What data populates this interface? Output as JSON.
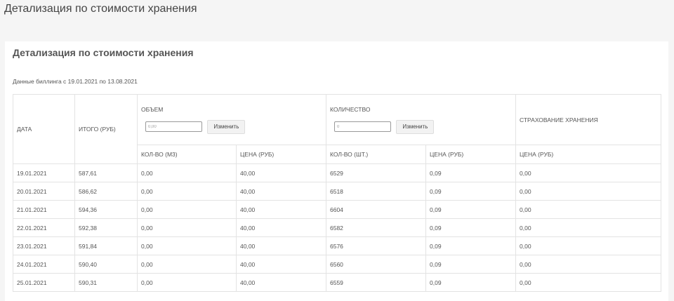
{
  "page": {
    "title": "Детализация по стоимости хранения"
  },
  "card": {
    "title": "Детализация по стоимости хранения",
    "billing_period": "Данные биллинга с 19.01.2021 по 13.08.2021"
  },
  "table": {
    "headers": {
      "date": "ДАТА",
      "total": "ИТОГО (РУБ)",
      "volume_group": "ОБЪЕМ",
      "quantity_group": "КОЛИЧЕСТВО",
      "insurance": "СТРАХОВАНИЕ ХРАНЕНИЯ",
      "vol_qty": "КОЛ-ВО (М3)",
      "vol_price": "ЦЕНА (РУБ)",
      "qty_qty": "КОЛ-ВО (ШТ.)",
      "qty_price": "ЦЕНА (РУБ)",
      "ins_price": "ЦЕНА (РУБ)"
    },
    "volume_input": {
      "value": "0,00"
    },
    "quantity_input": {
      "value": "0"
    },
    "change_label": "Изменить",
    "rows": [
      [
        "19.01.2021",
        "587,61",
        "0,00",
        "40,00",
        "6529",
        "0,09",
        "0,00"
      ],
      [
        "20.01.2021",
        "586,62",
        "0,00",
        "40,00",
        "6518",
        "0,09",
        "0,00"
      ],
      [
        "21.01.2021",
        "594,36",
        "0,00",
        "40,00",
        "6604",
        "0,09",
        "0,00"
      ],
      [
        "22.01.2021",
        "592,38",
        "0,00",
        "40,00",
        "6582",
        "0,09",
        "0,00"
      ],
      [
        "23.01.2021",
        "591,84",
        "0,00",
        "40,00",
        "6576",
        "0,09",
        "0,00"
      ],
      [
        "24.01.2021",
        "590,40",
        "0,00",
        "40,00",
        "6560",
        "0,09",
        "0,00"
      ],
      [
        "25.01.2021",
        "590,31",
        "0,00",
        "40,00",
        "6559",
        "0,09",
        "0,00"
      ]
    ]
  }
}
